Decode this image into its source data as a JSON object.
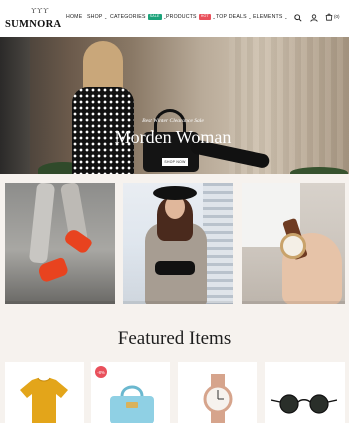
{
  "header": {
    "logo_text": "SUMNORA",
    "nav": [
      {
        "label": "HOME",
        "caret": false,
        "badge": null
      },
      {
        "label": "SHOP",
        "caret": true,
        "badge": null
      },
      {
        "label": "CATEGORIES",
        "caret": true,
        "badge": {
          "text": "SALE",
          "color": "#1ba37a"
        }
      },
      {
        "label": "PRODUCTS",
        "caret": true,
        "badge": {
          "text": "HOT",
          "color": "#e9505b"
        }
      },
      {
        "label": "TOP DEALS",
        "caret": true,
        "badge": null
      },
      {
        "label": "ELEMENTS",
        "caret": true,
        "badge": null
      }
    ],
    "icons": [
      "search-icon",
      "user-icon",
      "cart-icon"
    ],
    "cart_count": "(0)"
  },
  "hero": {
    "subtitle": "Best Winter Clearance Sale",
    "title": "Morden Woman",
    "button_label": "SHOP NOW"
  },
  "tiles": [
    "sneakers-banner",
    "fashion-woman-banner",
    "watch-banner"
  ],
  "featured": {
    "title": "Featured Items",
    "products": [
      {
        "name": "yellow-tshirt",
        "badge": null
      },
      {
        "name": "blue-handbag",
        "badge": "-8%"
      },
      {
        "name": "rose-gold-watch",
        "badge": null
      },
      {
        "name": "round-sunglasses",
        "badge": null
      }
    ]
  },
  "colors": {
    "accent_sale": "#1ba37a",
    "accent_hot": "#e9505b",
    "background": "#f6f2ee"
  }
}
